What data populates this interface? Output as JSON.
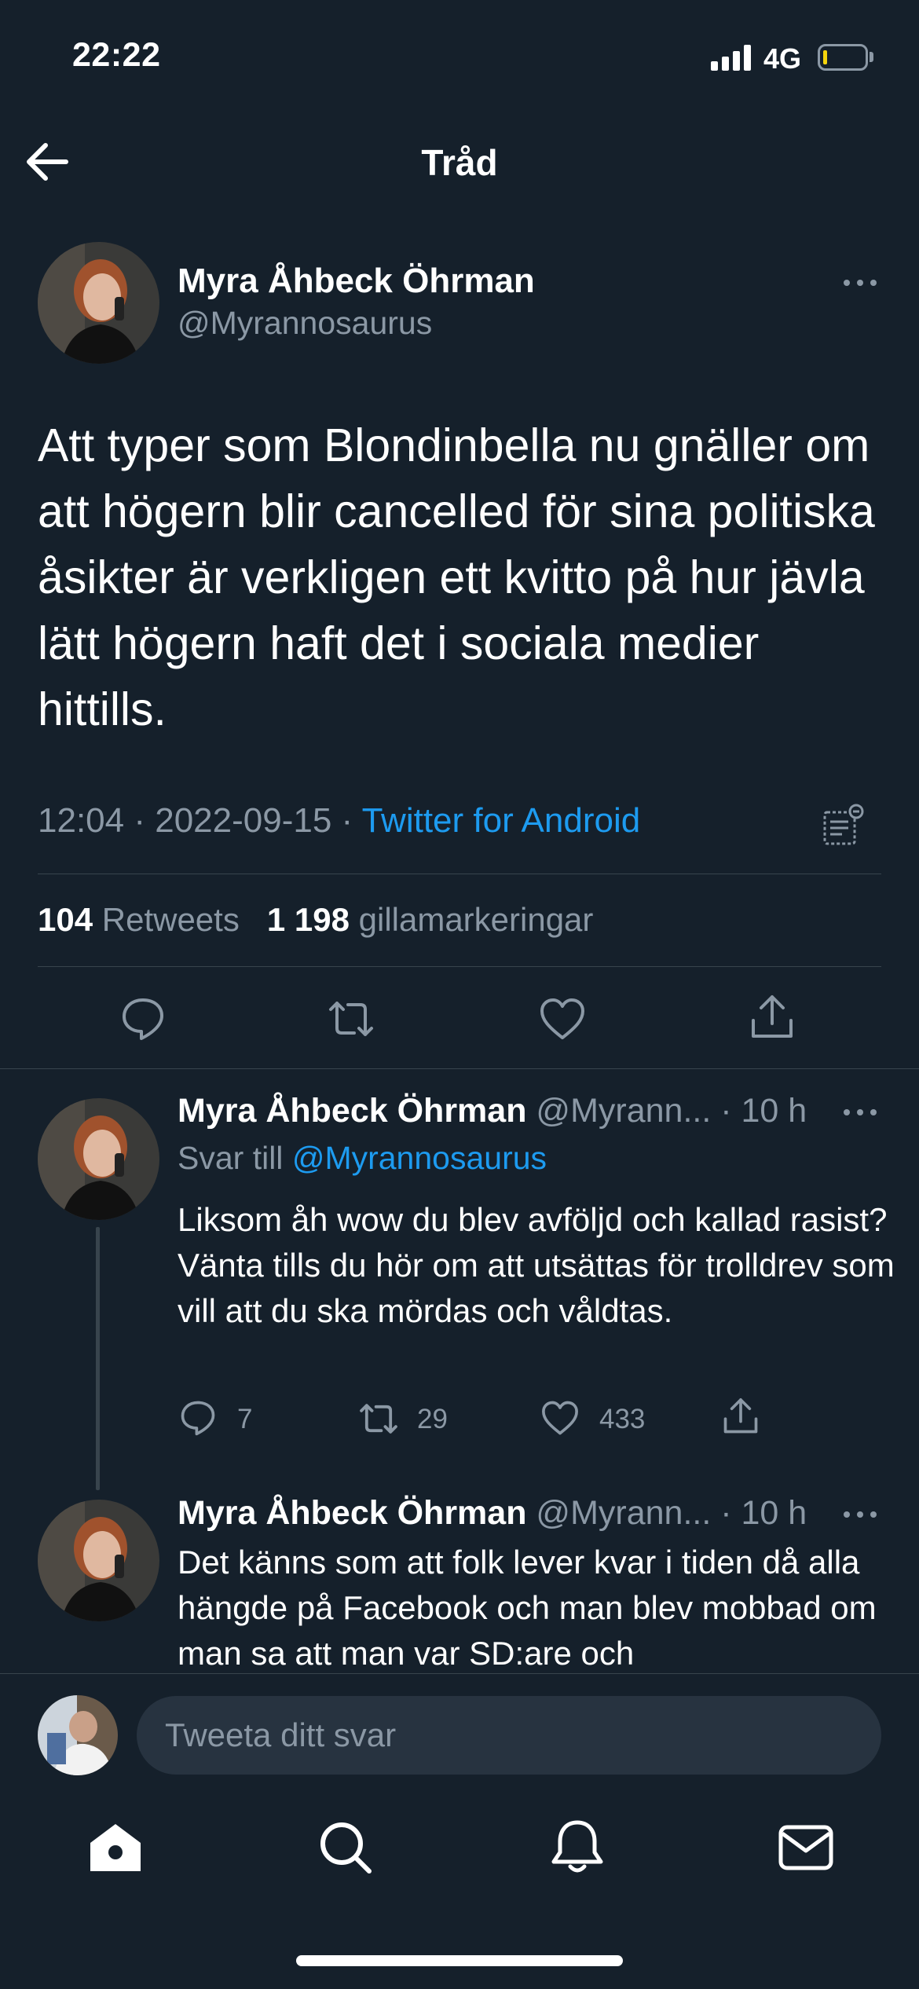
{
  "status_bar": {
    "time": "22:22",
    "network": "4G"
  },
  "header": {
    "title": "Tråd"
  },
  "main_tweet": {
    "author_name": "Myra Åhbeck Öhrman",
    "author_handle": "@Myrannosaurus",
    "text": "Att typer som Blondinbella nu gnäller om att högern blir cancelled för sina politiska åsikter är verkligen ett kvitto på hur jävla lätt högern haft det i sociala medier hittills.",
    "time": "12:04",
    "date": "2022-09-15",
    "separator": " · ",
    "source": "Twitter for Android",
    "retweets_count": "104",
    "retweets_label": "Retweets",
    "likes_count": "1 198",
    "likes_label": "gillamarkeringar"
  },
  "replies": [
    {
      "author_name": "Myra Åhbeck Öhrman",
      "author_handle": "@Myrann...",
      "time": "· 10 h",
      "reply_to_label": "Svar till",
      "reply_to_handle": "@Myrannosaurus",
      "text": "Liksom åh wow du blev avföljd och kallad rasist? Vänta tills du hör om att utsättas för trolldrev som vill att du ska mördas och våldtas.",
      "reply_count": "7",
      "retweet_count": "29",
      "like_count": "433"
    },
    {
      "author_name": "Myra Åhbeck Öhrman",
      "author_handle": "@Myrann...",
      "time": "· 10 h",
      "text": "Det känns som att folk lever kvar i tiden då alla hängde på Facebook och man blev mobbad om man sa att man var SD:are och"
    }
  ],
  "compose": {
    "placeholder": "Tweeta ditt svar"
  },
  "icons": {
    "back": "arrow-left-icon",
    "more": "more-dots-icon",
    "reply": "reply-icon",
    "retweet": "retweet-icon",
    "like": "heart-icon",
    "share": "share-icon",
    "stats": "analytics-icon",
    "home": "home-icon",
    "search": "search-icon",
    "notifications": "bell-icon",
    "messages": "mail-icon"
  },
  "colors": {
    "background": "#15202b",
    "link": "#1d9bf0",
    "muted": "#8b98a5",
    "divider": "#38444d",
    "battery_fill": "#f4d40c"
  }
}
